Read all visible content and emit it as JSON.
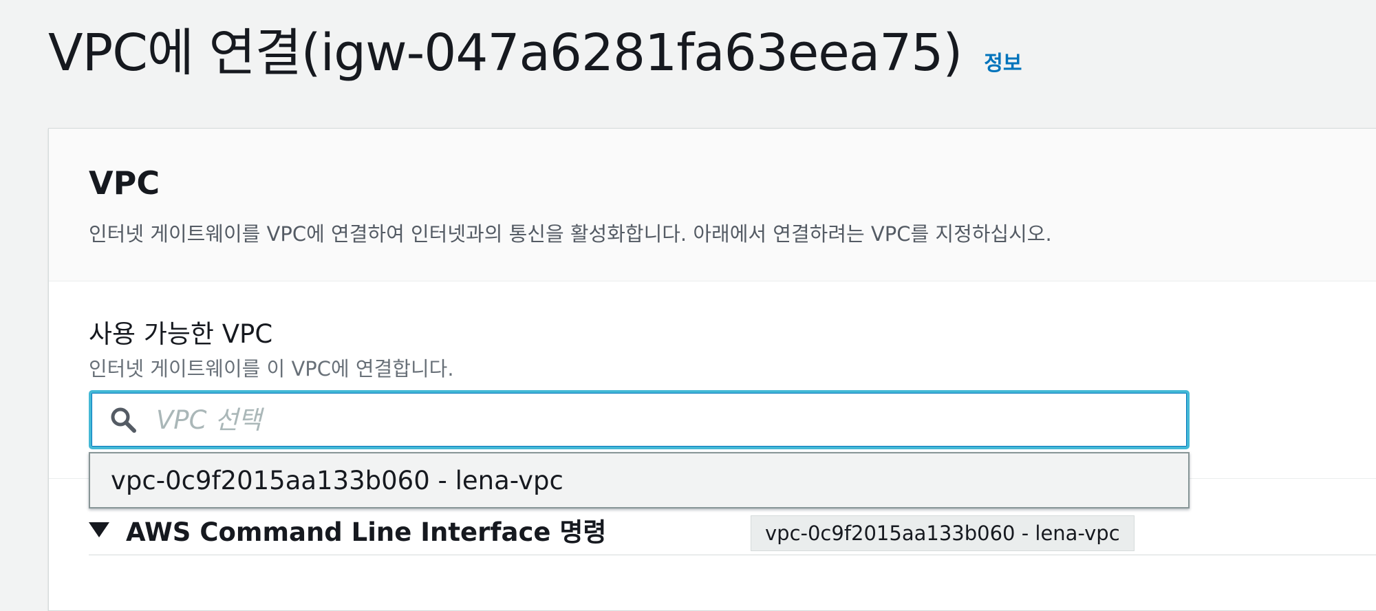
{
  "header": {
    "title": "VPC에 연결(igw-047a6281fa63eea75)",
    "info_link": "정보"
  },
  "section": {
    "title": "VPC",
    "description": "인터넷 게이트웨이를 VPC에 연결하여 인터넷과의 통신을 활성화합니다. 아래에서 연결하려는 VPC를 지정하십시오."
  },
  "vpc_field": {
    "label": "사용 가능한 VPC",
    "description": "인터넷 게이트웨이를 이 VPC에 연결합니다.",
    "placeholder": "VPC 선택",
    "value": "",
    "search_icon": "search-icon"
  },
  "dropdown": {
    "options": [
      {
        "label": "vpc-0c9f2015aa133b060 - lena-vpc"
      }
    ]
  },
  "cli": {
    "label": "AWS Command Line Interface 명령",
    "caret_icon": "caret-down-icon"
  },
  "tooltip": {
    "text": "vpc-0c9f2015aa133b060 - lena-vpc"
  },
  "colors": {
    "page_background": "#f2f3f3",
    "link": "#0073bb",
    "focus_border": "#44b9d6",
    "text_primary": "#16191f",
    "text_secondary": "#545b64"
  }
}
